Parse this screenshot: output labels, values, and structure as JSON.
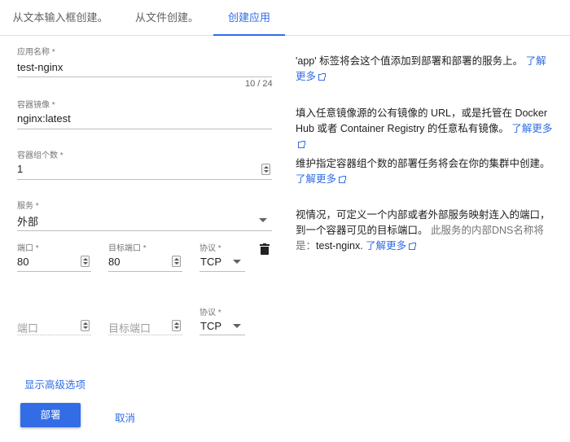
{
  "tabs": [
    {
      "label": "从文本输入框创建。"
    },
    {
      "label": "从文件创建。"
    },
    {
      "label": "创建应用"
    }
  ],
  "form": {
    "app_name": {
      "label": "应用名称 *",
      "value": "test-nginx",
      "counter": "10 / 24"
    },
    "image": {
      "label": "容器镜像 *",
      "value": "nginx:latest"
    },
    "pods": {
      "label": "容器组个数 *",
      "value": "1"
    },
    "service": {
      "label": "服务 *",
      "value": "外部"
    },
    "port_row_1": {
      "port": {
        "label": "端口 *",
        "value": "80"
      },
      "target_port": {
        "label": "目标端口 *",
        "value": "80"
      },
      "protocol": {
        "label": "协议 *",
        "value": "TCP"
      }
    },
    "port_row_2": {
      "port": {
        "placeholder": "端口"
      },
      "target_port": {
        "placeholder": "目标端口"
      },
      "protocol": {
        "label": "协议 *",
        "value": "TCP"
      }
    }
  },
  "help": {
    "app_name": {
      "text": "'app' 标签将会这个值添加到部署和部署的服务上。",
      "link": "了解更多"
    },
    "image": {
      "text": "填入任意镜像源的公有镜像的 URL，或是托管在 Docker Hub 或者 Container Registry 的任意私有镜像。",
      "link": "了解更多"
    },
    "pods": {
      "text": "维护指定容器组个数的部署任务将会在你的集群中创建。",
      "link": "了解更多"
    },
    "service": {
      "text": "视情况，可定义一个内部或者外部服务映射连入的端口，到一个容器可见的目标端口。",
      "name": "test-nginx.",
      "link": "了解更多",
      "dns_note": "此服务的内部DNS名称将是："
    }
  },
  "actions": {
    "advanced": "显示高级选项",
    "deploy": "部署",
    "cancel": "取消"
  },
  "colors": {
    "accent": "#326de6"
  }
}
